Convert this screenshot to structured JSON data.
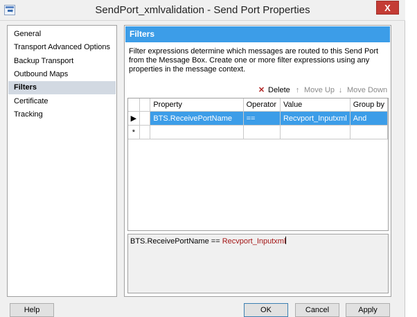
{
  "window": {
    "title": "SendPort_xmlvalidation - Send Port Properties",
    "close_label": "X"
  },
  "nav": {
    "items": [
      {
        "label": "General",
        "selected": false
      },
      {
        "label": "Transport Advanced Options",
        "selected": false
      },
      {
        "label": "Backup Transport",
        "selected": false
      },
      {
        "label": "Outbound Maps",
        "selected": false
      },
      {
        "label": "Filters",
        "selected": true
      },
      {
        "label": "Certificate",
        "selected": false
      },
      {
        "label": "Tracking",
        "selected": false
      }
    ]
  },
  "panel": {
    "header": "Filters",
    "description": "Filter expressions determine which messages are routed to this Send Port from the Message Box. Create one or more filter expressions using any properties in the message context."
  },
  "toolbar": {
    "delete_label": "Delete",
    "move_up_label": "Move Up",
    "move_down_label": "Move Down"
  },
  "grid": {
    "columns": [
      "Property",
      "Operator",
      "Value",
      "Group by"
    ],
    "rows": [
      {
        "property": "BTS.ReceivePortName",
        "operator": "==",
        "value": "Recvport_Inputxml",
        "group_by": "And"
      }
    ],
    "new_row_marker": "*"
  },
  "expression": {
    "property": "BTS.ReceivePortName",
    "operator": "==",
    "value": "Recvport_Inputxml"
  },
  "buttons": {
    "help": "Help",
    "ok": "OK",
    "cancel": "Cancel",
    "apply": "Apply"
  },
  "colors": {
    "accent": "#3c9de8",
    "expression_value": "#a31515",
    "close_button": "#c43c35"
  }
}
